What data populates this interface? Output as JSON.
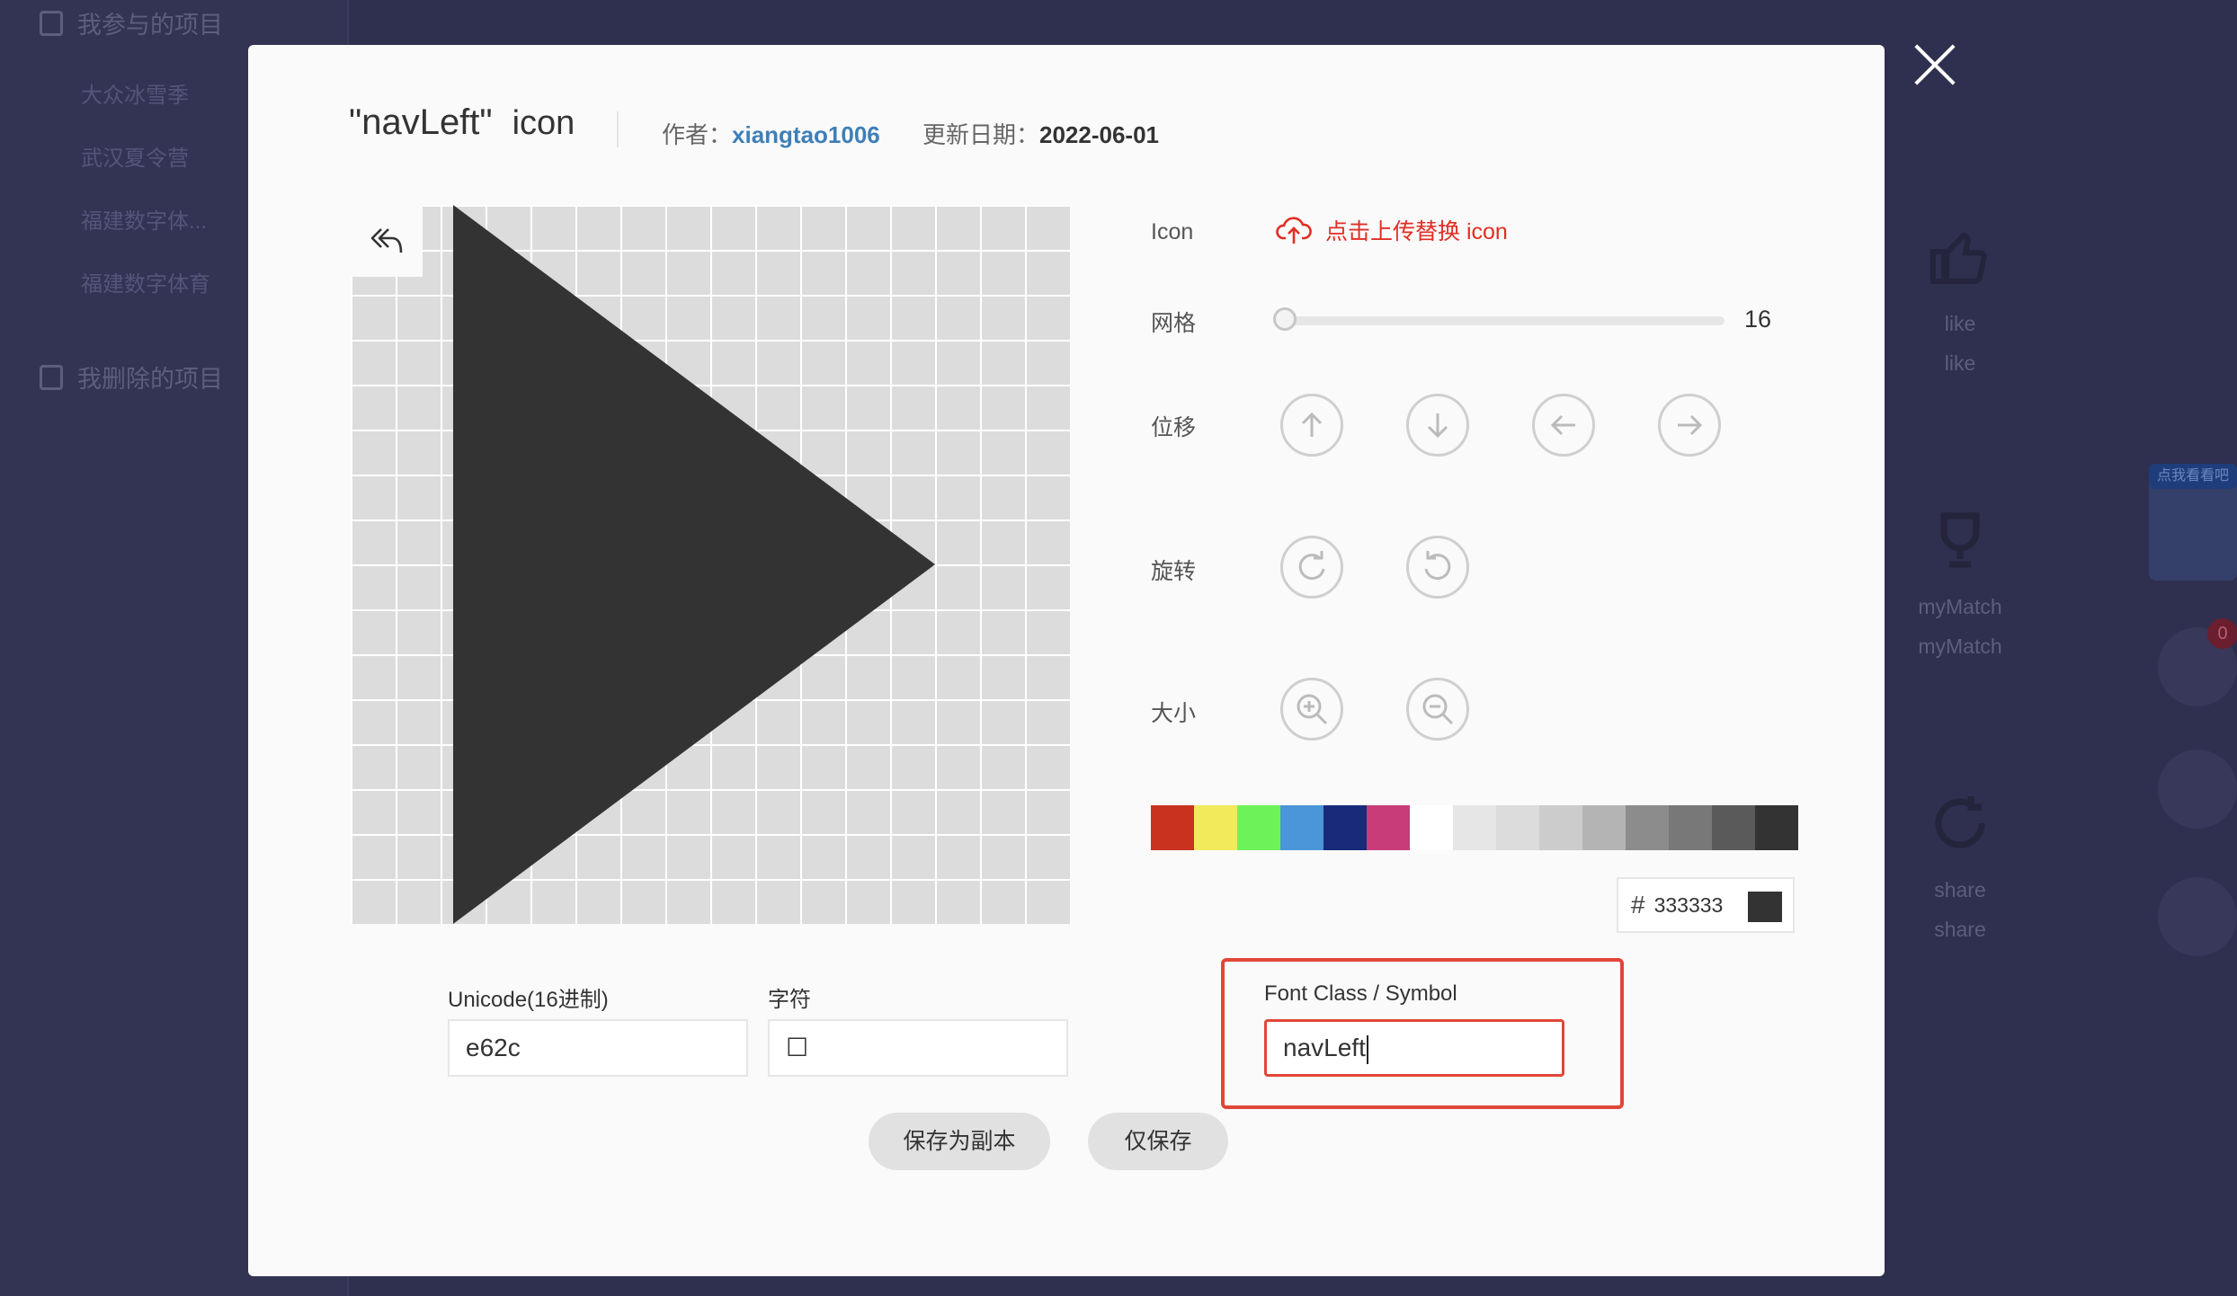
{
  "background": {
    "sidebar_sections": [
      {
        "label": "我参与的项目"
      },
      {
        "label": "我删除的项目"
      }
    ],
    "sidebar_items": [
      "大众冰雪季",
      "武汉夏令营",
      "福建数字体...",
      "福建数字体育"
    ],
    "actions": [
      {
        "label1": "like",
        "label2": "like",
        "icon": "thumbs-up-icon"
      },
      {
        "label1": "myMatch",
        "label2": "myMatch",
        "icon": "trophy-icon"
      },
      {
        "label1": "share",
        "label2": "share",
        "icon": "share-icon"
      }
    ],
    "promo_tag": "点我看看吧",
    "cart_badge": "0"
  },
  "modal": {
    "title_name": "\"navLeft\"",
    "title_suffix": "icon",
    "author_label": "作者：",
    "author": "xiangtao1006",
    "date_label": "更新日期：",
    "date": "2022-06-01",
    "controls": {
      "icon_label": "Icon",
      "upload_text": "点击上传替换 icon",
      "grid_label": "网格",
      "grid_value": "16",
      "grid_slider_fraction": 0.0,
      "move_label": "位移",
      "rotate_label": "旋转",
      "size_label": "大小"
    },
    "palette": [
      "#c8321e",
      "#f2ea5a",
      "#6ef25a",
      "#4a96d8",
      "#1a2a7a",
      "#c83c7a",
      "#ffffff",
      "#e6e6e6",
      "#dcdcdc",
      "#cccccc",
      "#b4b4b4",
      "#8c8c8c",
      "#787878",
      "#5a5a5a",
      "#333333"
    ],
    "color_hash": "#",
    "color_hex": "333333",
    "icon_color": "#333333",
    "fields": {
      "unicode_label": "Unicode(16进制)",
      "unicode_value": "e62c",
      "char_label": "字符",
      "char_value": "☐",
      "fontclass_label": "Font Class / Symbol",
      "fontclass_value": "navLeft"
    },
    "buttons": {
      "save_copy": "保存为副本",
      "save_only": "仅保存"
    }
  }
}
